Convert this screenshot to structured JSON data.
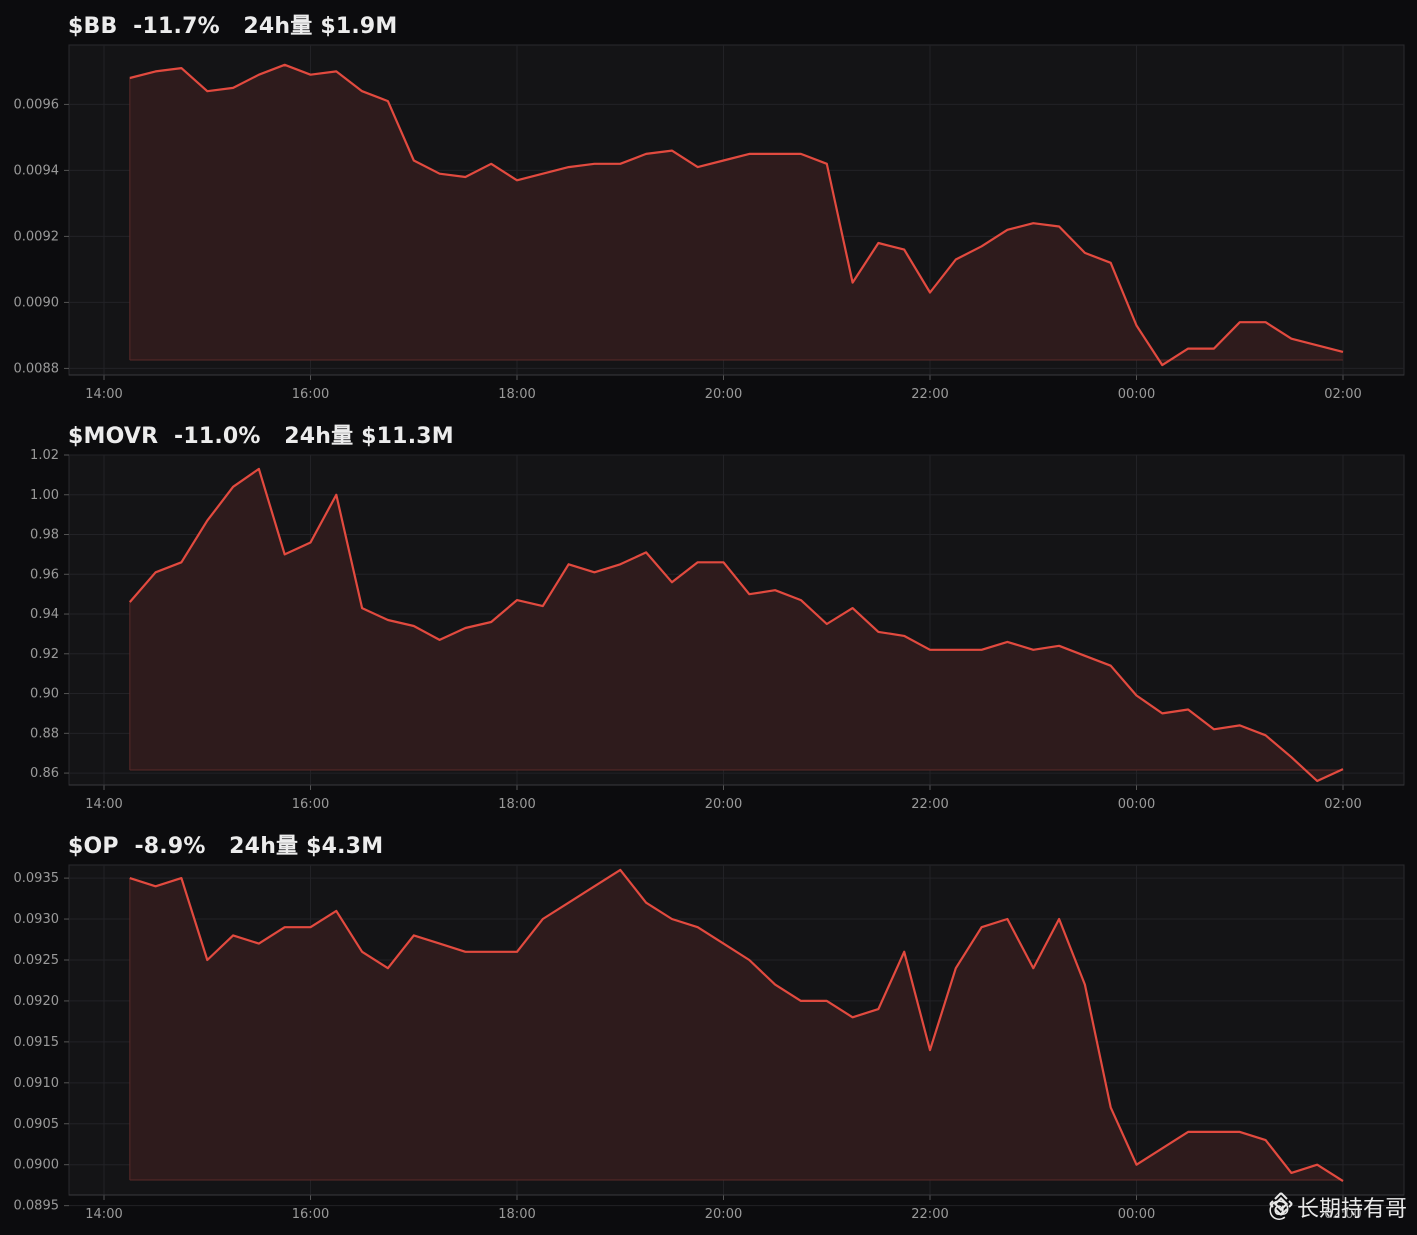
{
  "colors": {
    "background": "#0c0c0e",
    "panel": "#141416",
    "line": "#e24a3f",
    "fill": "#2f1b1c",
    "grid": "#222226",
    "tick_text": "#9a9a9a"
  },
  "watermark": {
    "text": "@ 长期持有哥",
    "icon": "binance-logo-icon"
  },
  "chart_data": [
    {
      "type": "area",
      "title": "$BB  -11.7%   24h量 $1.9M",
      "x_ticks": [
        "14:00",
        "16:00",
        "18:00",
        "20:00",
        "22:00",
        "00:00",
        "02:00"
      ],
      "x_hours": [
        14.25,
        14.5,
        14.75,
        15.0,
        15.25,
        15.5,
        15.75,
        16.0,
        16.25,
        16.5,
        16.75,
        17.0,
        17.25,
        17.5,
        17.75,
        18.0,
        18.25,
        18.5,
        18.75,
        19.0,
        19.25,
        19.5,
        19.75,
        20.0,
        20.25,
        20.5,
        20.75,
        21.0,
        21.25,
        21.5,
        21.75,
        22.0,
        22.25,
        22.5,
        22.75,
        23.0,
        23.25,
        23.5,
        23.75,
        24.0,
        24.25,
        24.5,
        24.75,
        25.0,
        25.25,
        25.5,
        25.75,
        26.0
      ],
      "y_ticks": [
        0.0088,
        0.009,
        0.0092,
        0.0094,
        0.0096
      ],
      "y_tick_labels": [
        "0.0088",
        "0.0090",
        "0.0092",
        "0.0094",
        "0.0096"
      ],
      "ylim": [
        0.00878,
        0.00978
      ],
      "values": [
        0.00968,
        0.0097,
        0.00971,
        0.00964,
        0.00965,
        0.00969,
        0.00972,
        0.00969,
        0.0097,
        0.00964,
        0.00961,
        0.00943,
        0.00939,
        0.00938,
        0.00942,
        0.00937,
        0.00939,
        0.00941,
        0.00942,
        0.00942,
        0.00945,
        0.00946,
        0.00941,
        0.00943,
        0.00945,
        0.00945,
        0.00945,
        0.00942,
        0.00906,
        0.00918,
        0.00916,
        0.00903,
        0.00913,
        0.00917,
        0.00922,
        0.00924,
        0.00923,
        0.00915,
        0.00912,
        0.00893,
        0.00881,
        0.00886,
        0.00886,
        0.00894,
        0.00894,
        0.00889,
        0.00887,
        0.00885
      ]
    },
    {
      "type": "area",
      "title": "$MOVR  -11.0%   24h量 $11.3M",
      "x_ticks": [
        "14:00",
        "16:00",
        "18:00",
        "20:00",
        "22:00",
        "00:00",
        "02:00"
      ],
      "x_hours": [
        14.25,
        14.5,
        14.75,
        15.0,
        15.25,
        15.5,
        15.75,
        16.0,
        16.25,
        16.5,
        16.75,
        17.0,
        17.25,
        17.5,
        17.75,
        18.0,
        18.25,
        18.5,
        18.75,
        19.0,
        19.25,
        19.5,
        19.75,
        20.0,
        20.25,
        20.5,
        20.75,
        21.0,
        21.25,
        21.5,
        21.75,
        22.0,
        22.25,
        22.5,
        22.75,
        23.0,
        23.25,
        23.5,
        23.75,
        24.0,
        24.25,
        24.5,
        24.75,
        25.0,
        25.25,
        25.5,
        25.75,
        26.0
      ],
      "y_ticks": [
        0.86,
        0.88,
        0.9,
        0.92,
        0.94,
        0.96,
        0.98,
        1.0,
        1.02
      ],
      "y_tick_labels": [
        "0.86",
        "0.88",
        "0.90",
        "0.92",
        "0.94",
        "0.96",
        "0.98",
        "1.00",
        "1.02"
      ],
      "ylim": [
        0.854,
        1.02
      ],
      "values": [
        0.946,
        0.961,
        0.966,
        0.987,
        1.004,
        1.013,
        0.97,
        0.976,
        1.0,
        0.943,
        0.937,
        0.934,
        0.927,
        0.933,
        0.936,
        0.947,
        0.944,
        0.965,
        0.961,
        0.965,
        0.971,
        0.956,
        0.966,
        0.966,
        0.95,
        0.952,
        0.947,
        0.935,
        0.943,
        0.931,
        0.929,
        0.922,
        0.922,
        0.922,
        0.926,
        0.922,
        0.924,
        0.919,
        0.914,
        0.899,
        0.89,
        0.892,
        0.882,
        0.884,
        0.879,
        0.868,
        0.856,
        0.862
      ]
    },
    {
      "type": "area",
      "title": "$OP  -8.9%   24h量 $4.3M",
      "x_ticks": [
        "14:00",
        "16:00",
        "18:00",
        "20:00",
        "22:00",
        "00:00",
        "02:00"
      ],
      "x_hours": [
        14.25,
        14.5,
        14.75,
        15.0,
        15.25,
        15.5,
        15.75,
        16.0,
        16.25,
        16.5,
        16.75,
        17.0,
        17.25,
        17.5,
        17.75,
        18.0,
        18.25,
        18.5,
        18.75,
        19.0,
        19.25,
        19.5,
        19.75,
        20.0,
        20.25,
        20.5,
        20.75,
        21.0,
        21.25,
        21.5,
        21.75,
        22.0,
        22.25,
        22.5,
        22.75,
        23.0,
        23.25,
        23.5,
        23.75,
        24.0,
        24.25,
        24.5,
        24.75,
        25.0,
        25.25,
        25.5,
        25.75,
        26.0
      ],
      "y_ticks": [
        0.0895,
        0.09,
        0.0905,
        0.091,
        0.0915,
        0.092,
        0.0925,
        0.093,
        0.0935
      ],
      "y_tick_labels": [
        "0.0895",
        "0.0900",
        "0.0905",
        "0.0910",
        "0.0915",
        "0.0920",
        "0.0925",
        "0.0930",
        "0.0935"
      ],
      "ylim": [
        0.08963,
        0.09366
      ],
      "values": [
        0.0935,
        0.0934,
        0.0935,
        0.0925,
        0.0928,
        0.0927,
        0.0929,
        0.0929,
        0.0931,
        0.0926,
        0.0924,
        0.0928,
        0.0927,
        0.0926,
        0.0926,
        0.0926,
        0.093,
        0.0932,
        0.0934,
        0.0936,
        0.0932,
        0.093,
        0.0929,
        0.0927,
        0.0925,
        0.0922,
        0.092,
        0.092,
        0.0918,
        0.0919,
        0.0926,
        0.0914,
        0.0924,
        0.0929,
        0.093,
        0.0924,
        0.093,
        0.0922,
        0.0907,
        0.09,
        0.0902,
        0.0904,
        0.0904,
        0.0904,
        0.0903,
        0.0899,
        0.09,
        0.0898
      ]
    }
  ]
}
